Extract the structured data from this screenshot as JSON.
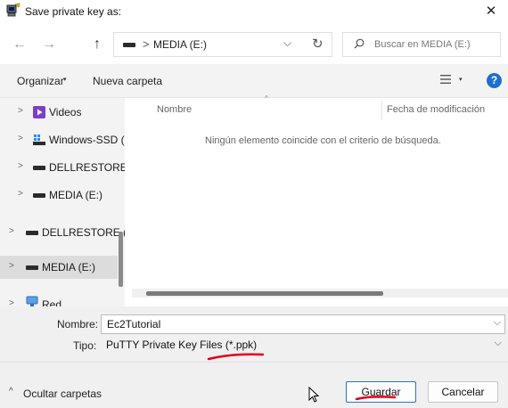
{
  "window": {
    "title": "Save private key as:",
    "close_glyph": "✕"
  },
  "nav": {
    "back_glyph": "←",
    "forward_glyph": "→",
    "up_glyph": "↑",
    "address_sep": ">",
    "address": "MEDIA (E:)",
    "address_chevron": "⌵",
    "refresh_glyph": "↻",
    "search_placeholder": "Buscar en MEDIA (E:)"
  },
  "toolbar": {
    "organize": "Organizar",
    "caret": "▾",
    "new_folder": "Nueva carpeta",
    "help": "?"
  },
  "sidebar": {
    "chevron": ">",
    "items": [
      {
        "label": "Videos",
        "icon": "video-folder-icon"
      },
      {
        "label": "Windows-SSD (",
        "icon": "windows-drive-icon"
      },
      {
        "label": "DELLRESTORE (",
        "icon": "drive-icon"
      },
      {
        "label": "MEDIA (E:)",
        "icon": "drive-icon"
      },
      {
        "label": "DELLRESTORE (D",
        "icon": "drive-icon"
      },
      {
        "label": "MEDIA (E:)",
        "icon": "drive-icon",
        "selected": true
      },
      {
        "label": "Red",
        "icon": "network-icon"
      }
    ]
  },
  "content": {
    "col_name": "Nombre",
    "col_date": "Fecha de modificación",
    "sort_glyph": "^",
    "empty_message": "Ningún elemento coincide con el criterio de búsqueda."
  },
  "form": {
    "name_label": "Nombre:",
    "name_value": "Ec2Tutorial",
    "type_label": "Tipo:",
    "type_value": "PuTTY Private Key Files (*.ppk)",
    "chevron": "⌵"
  },
  "footer": {
    "hide_folders": "Ocultar carpetas",
    "hide_glyph": "^",
    "save_button": "Guardar",
    "cancel_button": "Cancelar"
  },
  "colors": {
    "accent": "#1e6fd0",
    "annotation": "#e0001b",
    "selection": "#dcdcdc"
  }
}
